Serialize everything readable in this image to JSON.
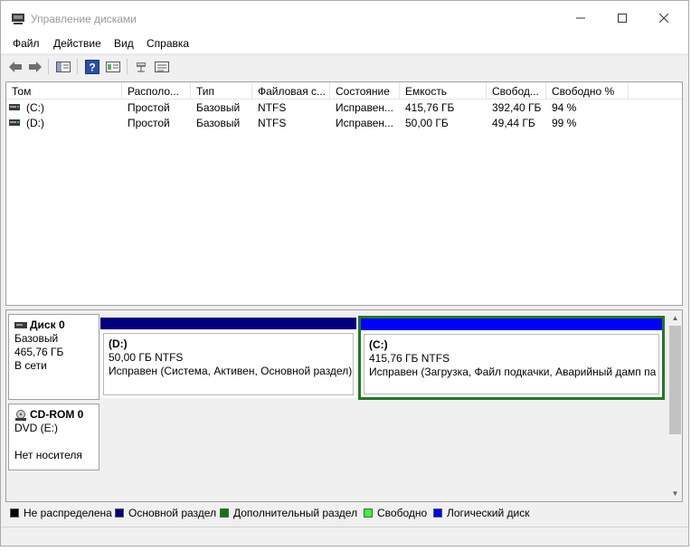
{
  "window": {
    "title": "Управление дисками",
    "controls": {
      "minimize_icon": "minimize-icon",
      "maximize_icon": "maximize-icon",
      "close_icon": "close-icon"
    }
  },
  "menu": {
    "items": [
      "Файл",
      "Действие",
      "Вид",
      "Справка"
    ]
  },
  "toolbar": {
    "icons": [
      "back-icon",
      "forward-icon",
      "show-hide-tree-icon",
      "help-icon",
      "properties-icon",
      "connect-disk-icon",
      "list-view-icon"
    ]
  },
  "volume_list": {
    "columns": [
      "Том",
      "Располо...",
      "Тип",
      "Файловая с...",
      "Состояние",
      "Емкость",
      "Свобод...",
      "Свободно %"
    ],
    "rows": [
      [
        "(C:)",
        "Простой",
        "Базовый",
        "NTFS",
        "Исправен...",
        "415,76 ГБ",
        "392,40 ГБ",
        "94 %"
      ],
      [
        "(D:)",
        "Простой",
        "Базовый",
        "NTFS",
        "Исправен...",
        "50,00 ГБ",
        "49,44 ГБ",
        "99 %"
      ]
    ]
  },
  "disks": {
    "disk0": {
      "name": "Диск 0",
      "type": "Базовый",
      "size": "465,76 ГБ",
      "status": "В сети",
      "partitions": [
        {
          "name": "(D:)",
          "size_fs": "50,00 ГБ NTFS",
          "status": "Исправен (Система, Активен, Основной раздел)",
          "bar_color": "#000080",
          "selected": false
        },
        {
          "name": "(C:)",
          "size_fs": "415,76 ГБ NTFS",
          "status": "Исправен (Загрузка, Файл подкачки, Аварийный дамп па",
          "bar_color": "#0000ff",
          "selected": true
        }
      ]
    },
    "cdrom0": {
      "name": "CD-ROM 0",
      "type": "DVD (E:)",
      "status": "Нет носителя"
    }
  },
  "legend": {
    "items": [
      {
        "label": "Не распределена",
        "color": "#000000"
      },
      {
        "label": "Основной раздел",
        "color": "#000080"
      },
      {
        "label": "Дополнительный раздел",
        "color": "#008000"
      },
      {
        "label": "Свободно",
        "color": "#33ff33"
      },
      {
        "label": "Логический диск",
        "color": "#0000ff"
      }
    ]
  },
  "colors": {
    "selection_border": "#1f7a1f"
  }
}
